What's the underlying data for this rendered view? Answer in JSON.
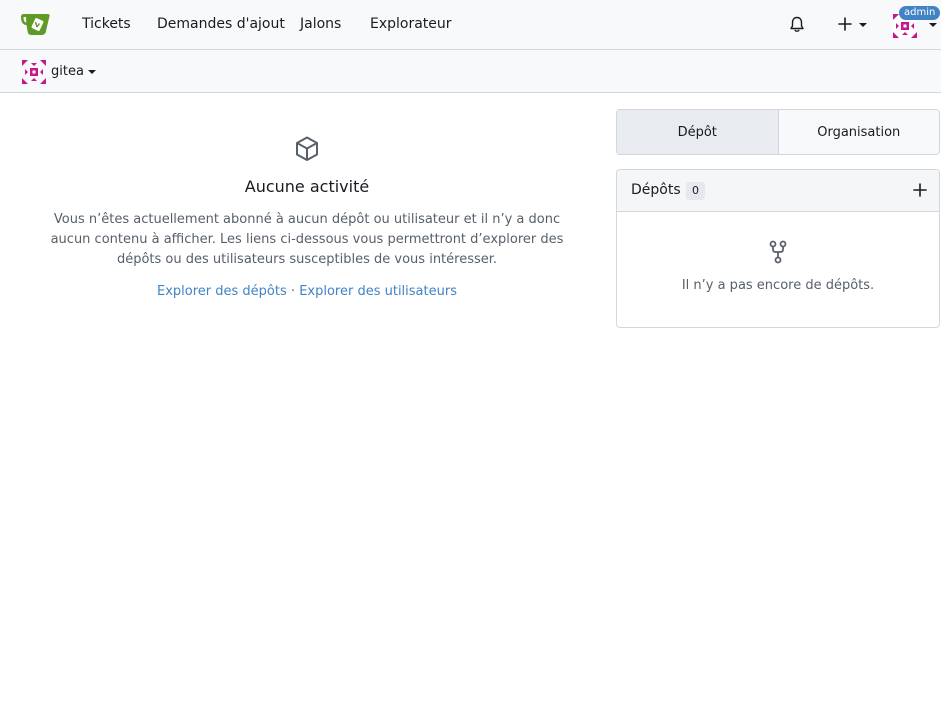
{
  "navbar": {
    "items": [
      {
        "label": "Tickets"
      },
      {
        "label": "Demandes d'ajout"
      },
      {
        "label": "Jalons"
      },
      {
        "label": "Explorateur"
      }
    ],
    "admin_badge": "admin",
    "icons": {
      "logo": "gitea-logo",
      "notifications": "bell-icon",
      "create": "plus-icon",
      "avatar": "user-avatar"
    }
  },
  "context": {
    "label": "gitea"
  },
  "feed": {
    "title": "Aucune activité",
    "description": "Vous n’êtes actuellement abonné à aucun dépôt ou utilisateur et il n’y a donc aucun contenu à afficher. Les liens ci-dessous vous permettront d’explorer des dépôts ou des utilisateurs susceptibles de vous intéresser.",
    "link_repos": "Explorer des dépôts",
    "separator": "·",
    "link_users": "Explorer des utilisateurs"
  },
  "sidebar": {
    "tabs": [
      {
        "label": "Dépôt",
        "active": true
      },
      {
        "label": "Organisation",
        "active": false
      }
    ],
    "repos": {
      "title": "Dépôts",
      "count": "0",
      "empty_text": "Il n’y a pas encore de dépôts."
    }
  },
  "colors": {
    "accent": "#4183c4",
    "logo_green": "#609926",
    "avatar_magenta": "#c8178c"
  }
}
